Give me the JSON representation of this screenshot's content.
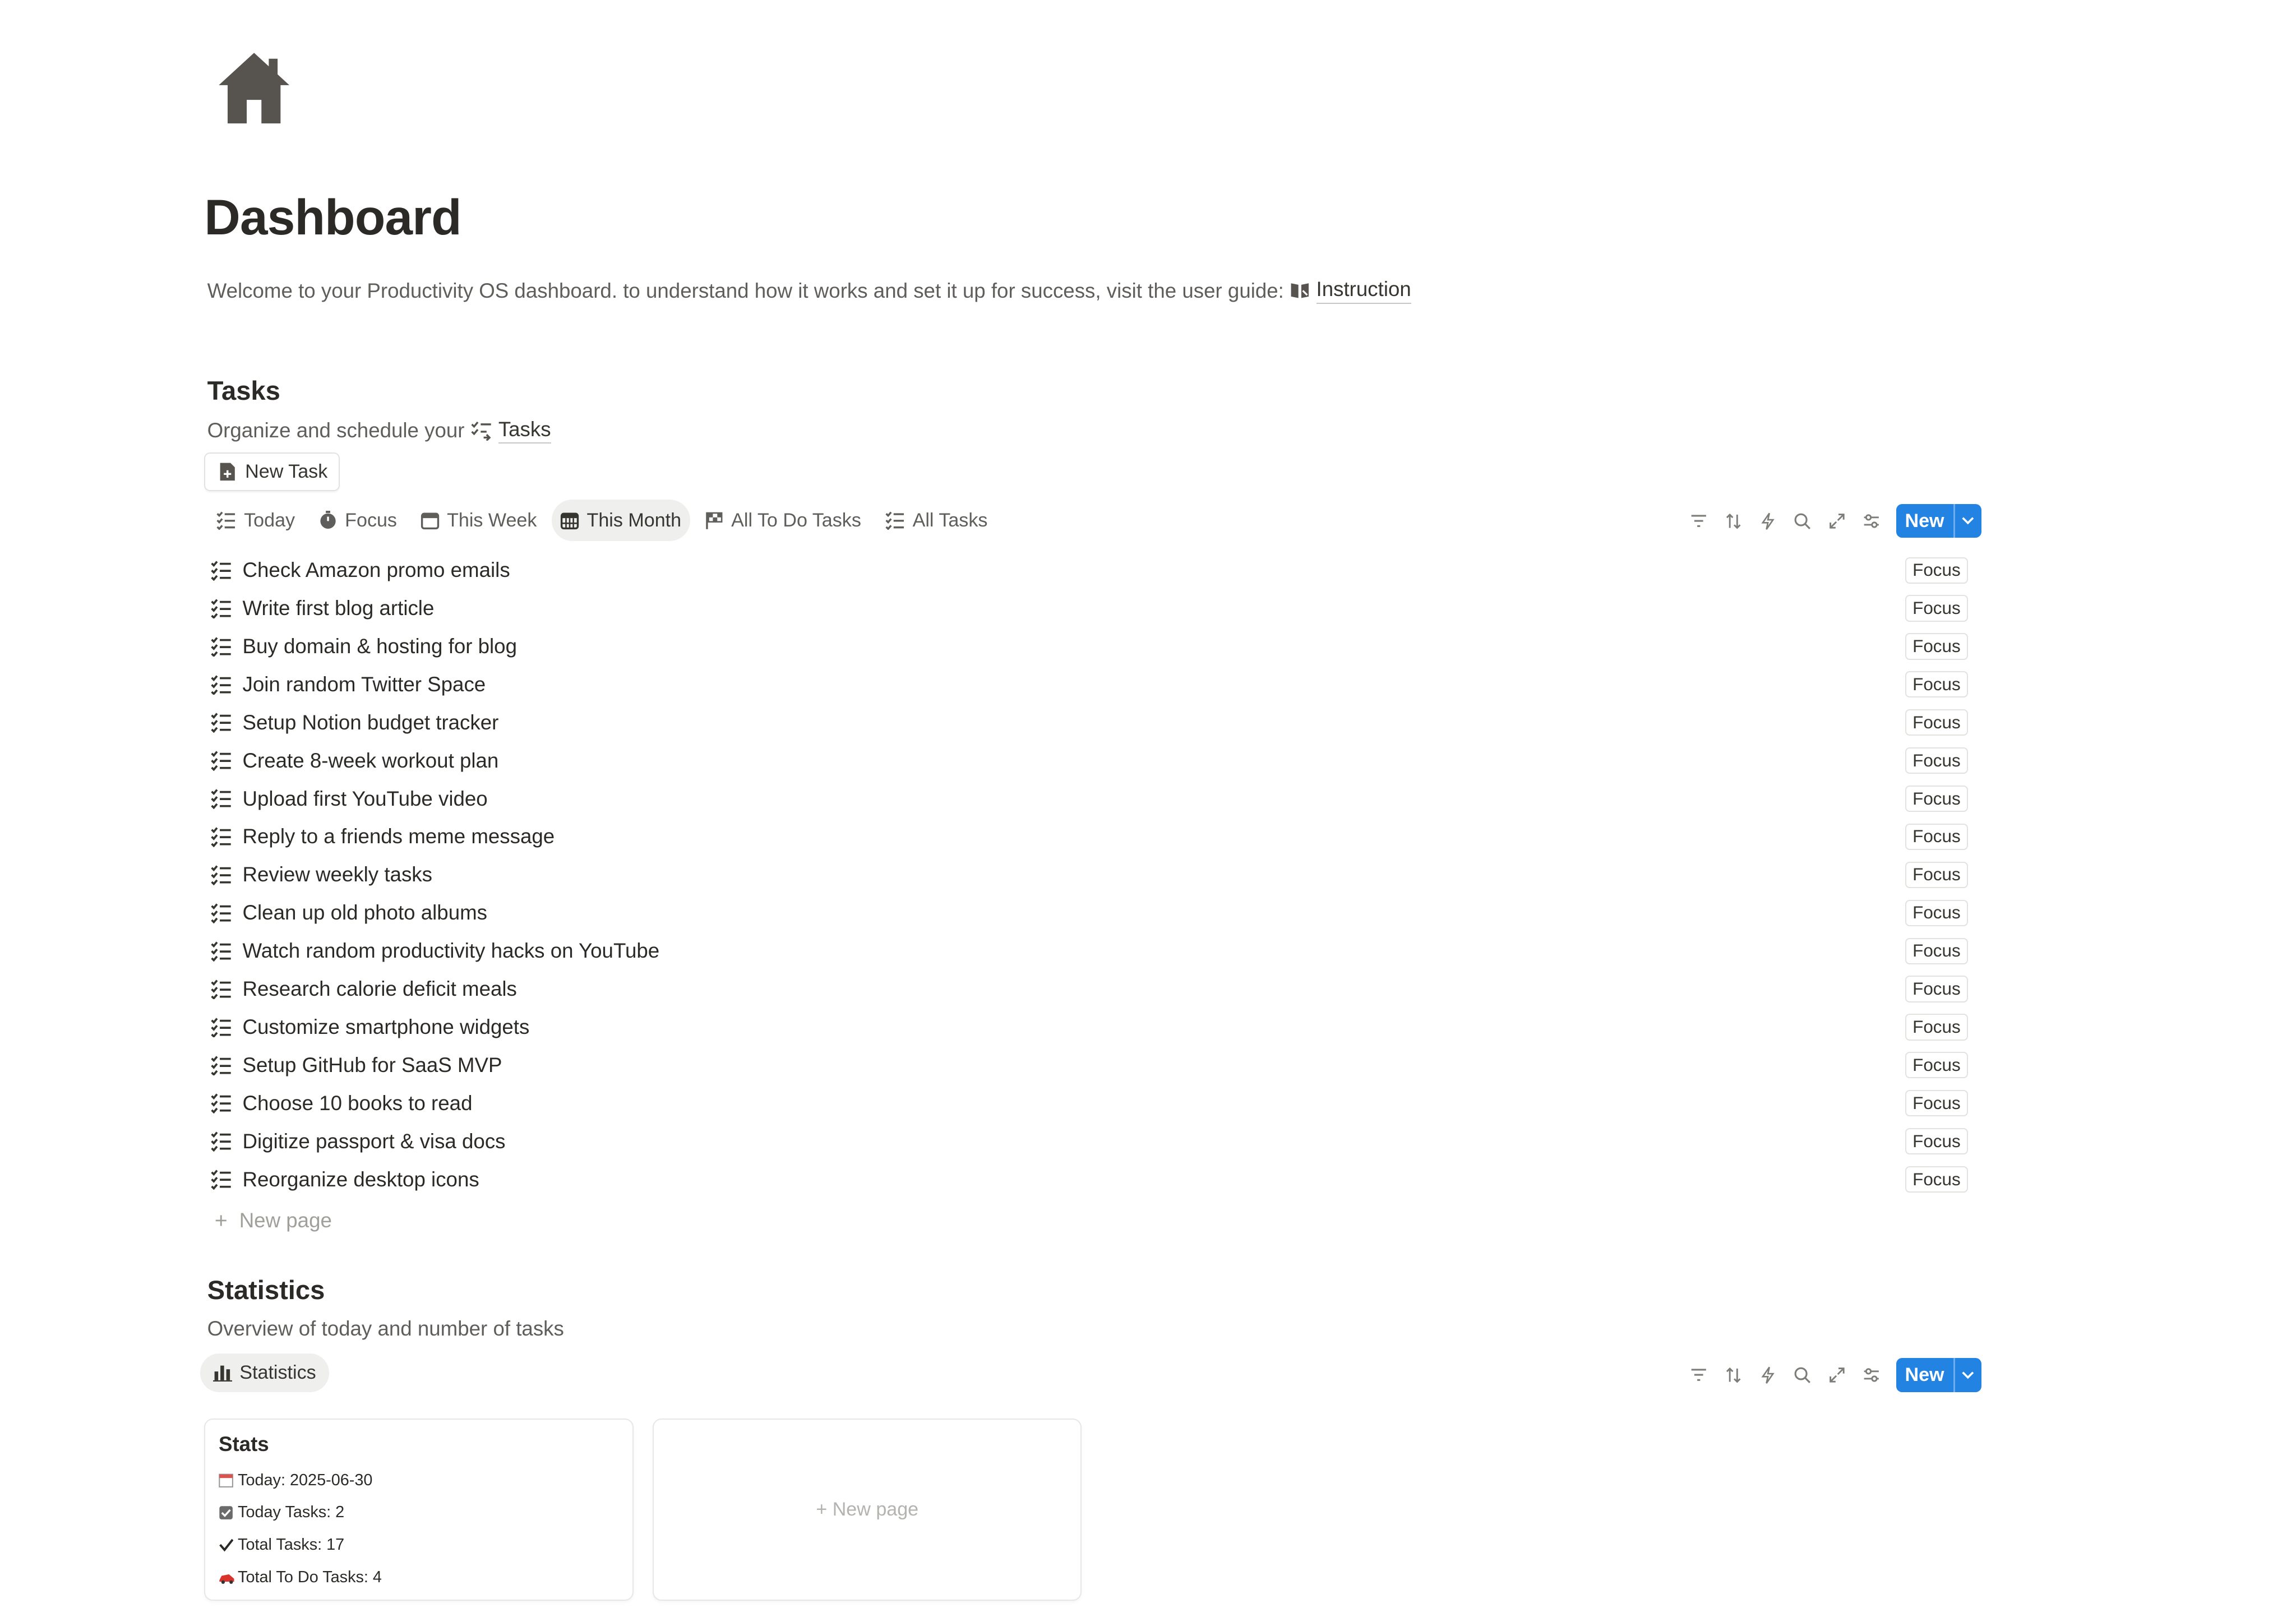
{
  "page": {
    "icon": "house-icon",
    "title": "Dashboard",
    "intro": "Welcome to your Productivity OS dashboard. to understand how it works and set it up for success, visit the user guide:",
    "intro_link": "Instruction"
  },
  "tasks_section": {
    "heading": "Tasks",
    "description": "Organize and schedule your",
    "link": "Tasks",
    "new_task_button": "New Task",
    "tabs": [
      "Today",
      "Focus",
      "This Week",
      "This Month",
      "All To Do Tasks",
      "All Tasks"
    ],
    "active_tab": "This Month",
    "new_button": "New",
    "items": [
      {
        "name": "Check Amazon promo emails",
        "tag": "Focus"
      },
      {
        "name": "Write first blog article",
        "tag": "Focus"
      },
      {
        "name": "Buy domain & hosting for blog",
        "tag": "Focus"
      },
      {
        "name": "Join random Twitter Space",
        "tag": "Focus"
      },
      {
        "name": "Setup Notion budget tracker",
        "tag": "Focus"
      },
      {
        "name": "Create 8-week workout plan",
        "tag": "Focus"
      },
      {
        "name": "Upload first YouTube video",
        "tag": "Focus"
      },
      {
        "name": "Reply to a friends meme message",
        "tag": "Focus"
      },
      {
        "name": "Review weekly tasks",
        "tag": "Focus"
      },
      {
        "name": "Clean up old photo albums",
        "tag": "Focus"
      },
      {
        "name": "Watch random productivity hacks on YouTube",
        "tag": "Focus"
      },
      {
        "name": "Research calorie deficit meals",
        "tag": "Focus"
      },
      {
        "name": "Customize smartphone widgets",
        "tag": "Focus"
      },
      {
        "name": "Setup GitHub for SaaS MVP",
        "tag": "Focus"
      },
      {
        "name": "Choose 10 books to read",
        "tag": "Focus"
      },
      {
        "name": "Digitize passport & visa docs",
        "tag": "Focus"
      },
      {
        "name": "Reorganize desktop icons",
        "tag": "Focus"
      }
    ],
    "new_page": "New page"
  },
  "statistics_section": {
    "heading": "Statistics",
    "description": "Overview of today and number of tasks",
    "tab": "Statistics",
    "new_button": "New",
    "card": {
      "title": "Stats",
      "lines": [
        {
          "icon": "calendar-icon",
          "text": "Today: 2025-06-30"
        },
        {
          "icon": "checkbox-icon",
          "text": "Today Tasks: 2"
        },
        {
          "icon": "checkmark-icon",
          "text": "Total Tasks: 17"
        },
        {
          "icon": "red-car-icon",
          "text": "Total To Do Tasks: 4"
        }
      ]
    },
    "new_page": "New page"
  },
  "colors": {
    "accent": "#2383e2",
    "text": "#37352f",
    "muted": "#5f5e5b"
  }
}
